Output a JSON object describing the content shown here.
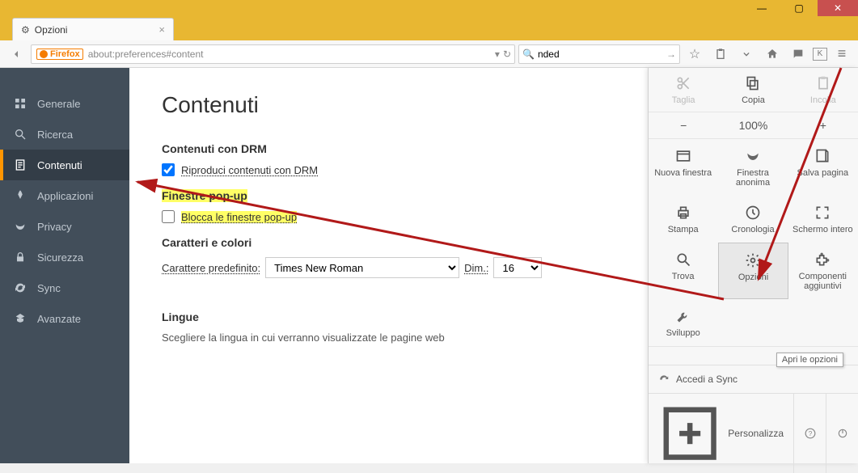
{
  "window": {
    "tab_title": "Opzioni"
  },
  "nav": {
    "identity": "Firefox",
    "url": "about:preferences#content",
    "search_value": "nded"
  },
  "sidebar": {
    "items": [
      {
        "label": "Generale"
      },
      {
        "label": "Ricerca"
      },
      {
        "label": "Contenuti"
      },
      {
        "label": "Applicazioni"
      },
      {
        "label": "Privacy"
      },
      {
        "label": "Sicurezza"
      },
      {
        "label": "Sync"
      },
      {
        "label": "Avanzate"
      }
    ],
    "active_index": 2
  },
  "main": {
    "heading": "Contenuti",
    "drm": {
      "title": "Contenuti con DRM",
      "checkbox_label": "Riproduci contenuti con DRM",
      "checked": true
    },
    "popup": {
      "title": "Finestre pop-up",
      "checkbox_label": "Blocca le finestre pop-up",
      "checked": false
    },
    "fonts": {
      "title": "Caratteri e colori",
      "default_label": "Carattere predefinito:",
      "default_value": "Times New Roman",
      "dim_label": "Dim.:",
      "dim_value": "16"
    },
    "lang": {
      "title": "Lingue",
      "desc": "Scegliere la lingua in cui verranno visualizzate le pagine web"
    }
  },
  "menu": {
    "cut": "Taglia",
    "copy": "Copia",
    "paste": "Incolla",
    "zoom": "100%",
    "grid": {
      "new_window": "Nuova finestra",
      "private": "Finestra anonima",
      "save_page": "Salva pagina",
      "print": "Stampa",
      "history": "Cronologia",
      "fullscreen": "Schermo intero",
      "find": "Trova",
      "options": "Opzioni",
      "addons": "Componenti aggiuntivi",
      "dev": "Sviluppo"
    },
    "tooltip": "Apri le opzioni",
    "sync": "Accedi a Sync",
    "customize": "Personalizza"
  }
}
